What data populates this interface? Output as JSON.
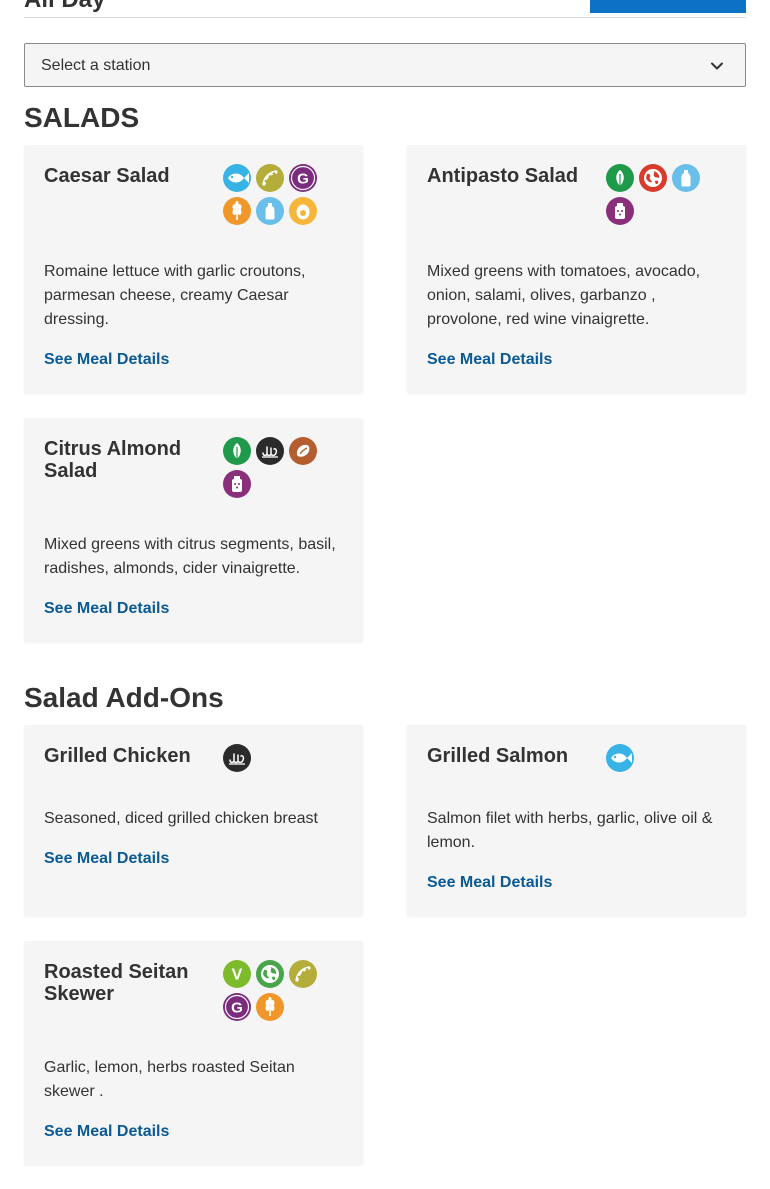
{
  "header": {
    "title": "All Day"
  },
  "station_select": {
    "placeholder": "Select a station"
  },
  "sections": [
    {
      "title": "SALADS"
    },
    {
      "title": "Salad Add-Ons"
    }
  ],
  "link_label": "See Meal Details",
  "meals": [
    {
      "name": "Caesar Salad",
      "description": "Romaine lettuce with garlic croutons, parmesan cheese, creamy Caesar dressing.",
      "icons": [
        "fish-icon",
        "soy-icon",
        "gluten-icon",
        "wheat-icon",
        "milk-icon",
        "egg-icon"
      ]
    },
    {
      "name": "Antipasto Salad",
      "description": "Mixed greens with tomatoes, avocado, onion, salami, olives, garbanzo , provolone, red wine vinaigrette.",
      "icons": [
        "vegetarian-icon",
        "climate-icon",
        "milk-icon",
        "sesame-icon"
      ]
    },
    {
      "name": "Citrus Almond Salad",
      "description": "Mixed greens with citrus segments, basil, radishes, almonds, cider vinaigrette.",
      "icons": [
        "vegetarian-icon",
        "halal-icon",
        "tree-nut-icon",
        "sesame-icon"
      ]
    },
    {
      "name": "Grilled Chicken",
      "description": "Seasoned, diced grilled chicken breast",
      "icons": [
        "halal-icon"
      ]
    },
    {
      "name": "Grilled Salmon",
      "description": "Salmon filet with herbs, garlic, olive oil & lemon.",
      "icons": [
        "fish-icon"
      ]
    },
    {
      "name": "Roasted Seitan Skewer",
      "description": "Garlic, lemon, herbs roasted Seitan skewer .",
      "icons": [
        "vegan-icon",
        "climate-friendly-icon",
        "soy-icon",
        "gluten-icon",
        "wheat-icon"
      ]
    }
  ],
  "colors": {
    "link": "#0a5a96",
    "card_bg": "#f5f5f5",
    "button": "#0b72c5"
  }
}
